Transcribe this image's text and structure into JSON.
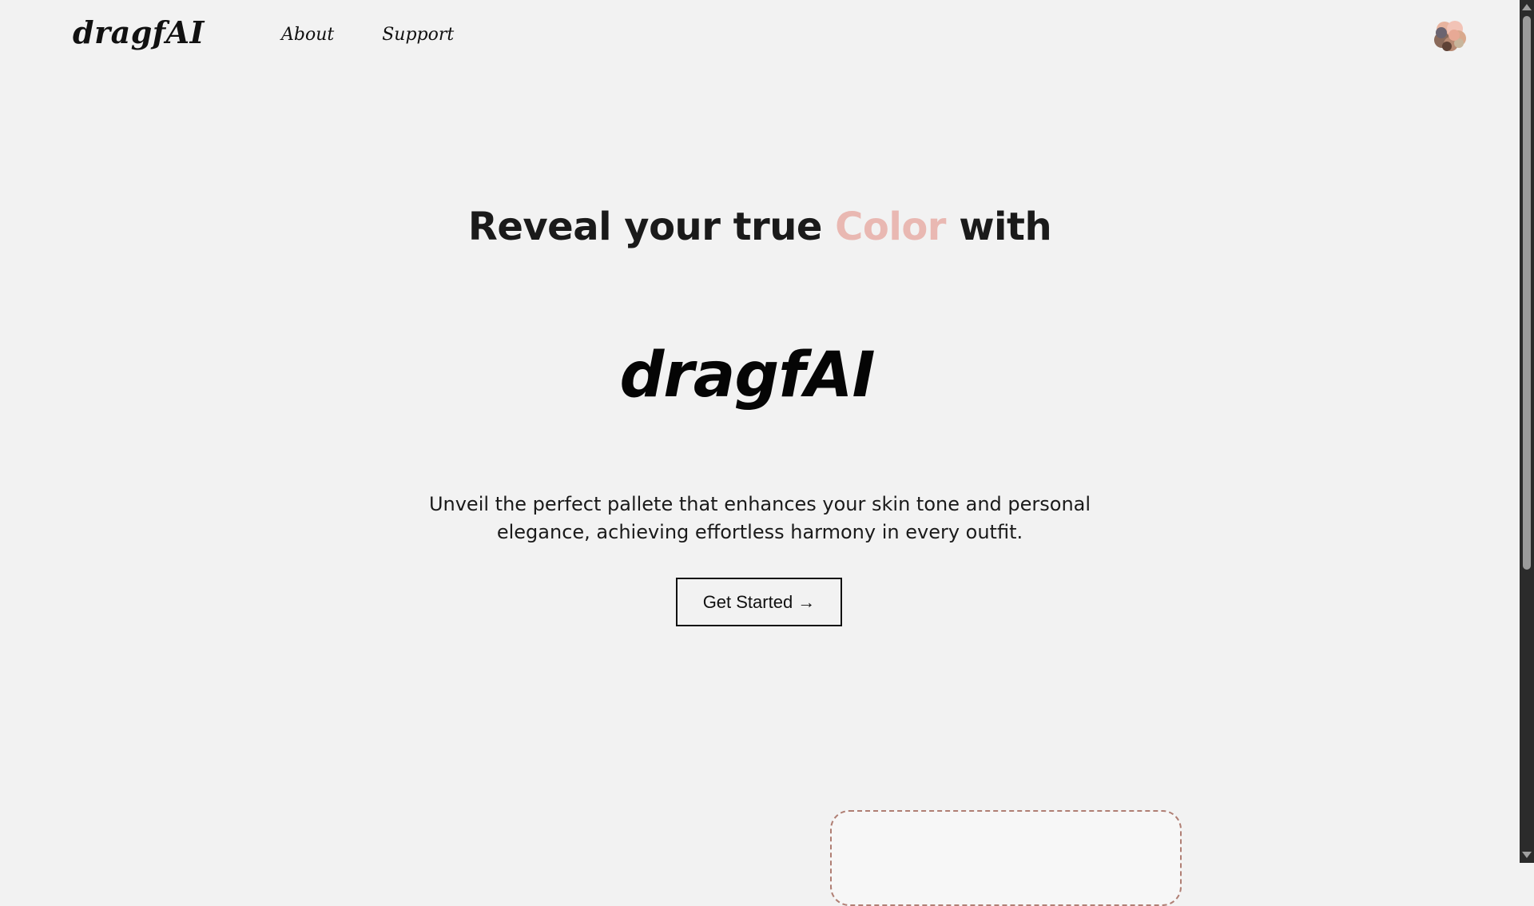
{
  "header": {
    "brand": "dragfAI",
    "nav": [
      {
        "label": "About"
      },
      {
        "label": "Support"
      }
    ],
    "avatar_icon": "color-palette-avatar-icon"
  },
  "hero": {
    "title_before": "Reveal your true ",
    "title_accent": "Color",
    "title_after": " with",
    "logo": "dragfAI",
    "description_line1": "Unveil the perfect pallete that enhances your skin tone and personal",
    "description_line2": "elegance, achieving effortless harmony in every outfit.",
    "cta_label": "Get Started →"
  },
  "colors": {
    "background": "#f2f2f2",
    "accent": "#e9b8b2",
    "upload_border": "#b07f74",
    "text": "#1a1a1a"
  }
}
